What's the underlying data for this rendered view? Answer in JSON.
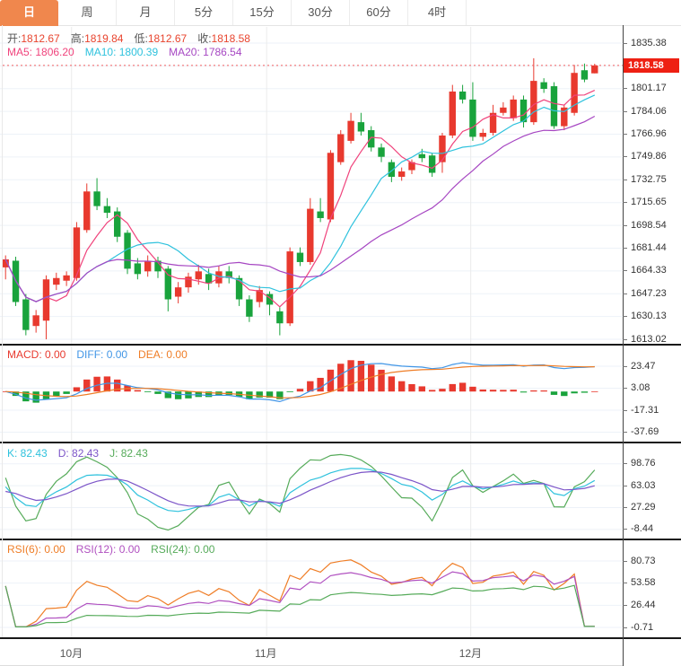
{
  "tabs": [
    {
      "label": "日",
      "active": true
    },
    {
      "label": "周",
      "active": false
    },
    {
      "label": "月",
      "active": false
    },
    {
      "label": "5分",
      "active": false
    },
    {
      "label": "15分",
      "active": false
    },
    {
      "label": "30分",
      "active": false
    },
    {
      "label": "60分",
      "active": false
    },
    {
      "label": "4时",
      "active": false
    }
  ],
  "ohlc_legend": [
    {
      "label": "开:",
      "value": "1812.67"
    },
    {
      "label": "高:",
      "value": "1819.84"
    },
    {
      "label": "低:",
      "value": "1812.67"
    },
    {
      "label": "收:",
      "value": "1818.58"
    }
  ],
  "ma_legend": [
    {
      "text": "MA5: 1806.20",
      "color": "#f0437c"
    },
    {
      "text": "MA10: 1800.39",
      "color": "#2fc2dd"
    },
    {
      "text": "MA20: 1786.54",
      "color": "#a646c2"
    }
  ],
  "macd_legend": [
    {
      "text": "MACD: 0.00",
      "color": "#e8392e"
    },
    {
      "text": "DIFF: 0.00",
      "color": "#4196e6"
    },
    {
      "text": "DEA: 0.00",
      "color": "#ef7d26"
    }
  ],
  "kdj_legend": [
    {
      "text": "K: 82.43",
      "color": "#2fc2dd"
    },
    {
      "text": "D: 82.43",
      "color": "#7c55c8"
    },
    {
      "text": "J: 82.43",
      "color": "#56ab5a"
    }
  ],
  "rsi_legend": [
    {
      "text": "RSI(6): 0.00",
      "color": "#ef7d26"
    },
    {
      "text": "RSI(12): 0.00",
      "color": "#b050c0"
    },
    {
      "text": "RSI(24): 0.00",
      "color": "#56ab5a"
    }
  ],
  "price_tag": "1818.58",
  "colors": {
    "up": "#e8392e",
    "down": "#19a33c",
    "ma5": "#f0437c",
    "ma10": "#2fc2dd",
    "ma20": "#a646c2",
    "diff": "#4196e6",
    "dea": "#ef7d26",
    "k": "#2fc2dd",
    "d_line": "#7c55c8",
    "j": "#56ab5a",
    "rsi6": "#ef7d26",
    "rsi12": "#b050c0",
    "rsi24": "#56ab5a",
    "tab_active": "#f0874d",
    "price_tag_bg": "#ee2013",
    "price_line": "#f26060",
    "grid_h": "#edf2f8",
    "grid_v": "#ebebeb",
    "legend_value_red": "#e8442e"
  },
  "chart_data": {
    "type": "candlestick",
    "timeframe": "日",
    "title": "Gold daily K-line with MA5/MA10/MA20, MACD, KDJ, RSI",
    "candles_ohlc_format": [
      "open",
      "high",
      "low",
      "close"
    ],
    "candles": [
      [
        1667,
        1676,
        1658,
        1673
      ],
      [
        1672,
        1675,
        1638,
        1641
      ],
      [
        1643,
        1647,
        1616,
        1620
      ],
      [
        1623,
        1635,
        1618,
        1631
      ],
      [
        1627,
        1661,
        1613,
        1658
      ],
      [
        1654,
        1663,
        1650,
        1659
      ],
      [
        1657,
        1664,
        1653,
        1661
      ],
      [
        1659,
        1701,
        1657,
        1697
      ],
      [
        1695,
        1730,
        1693,
        1724
      ],
      [
        1724,
        1734,
        1710,
        1713
      ],
      [
        1713,
        1719,
        1704,
        1708
      ],
      [
        1709,
        1712,
        1686,
        1690
      ],
      [
        1693,
        1695,
        1662,
        1666
      ],
      [
        1670,
        1674,
        1658,
        1662
      ],
      [
        1664,
        1676,
        1660,
        1672
      ],
      [
        1672,
        1675,
        1659,
        1664
      ],
      [
        1666,
        1668,
        1634,
        1643
      ],
      [
        1645,
        1656,
        1640,
        1652
      ],
      [
        1652,
        1663,
        1648,
        1660
      ],
      [
        1658,
        1669,
        1654,
        1664
      ],
      [
        1662,
        1666,
        1650,
        1655
      ],
      [
        1655,
        1668,
        1652,
        1664
      ],
      [
        1664,
        1668,
        1655,
        1659
      ],
      [
        1659,
        1661,
        1638,
        1643
      ],
      [
        1643,
        1646,
        1626,
        1630
      ],
      [
        1641,
        1653,
        1637,
        1650
      ],
      [
        1647,
        1649,
        1631,
        1639
      ],
      [
        1634,
        1637,
        1616,
        1625
      ],
      [
        1625,
        1682,
        1623,
        1679
      ],
      [
        1678,
        1682,
        1668,
        1671
      ],
      [
        1671,
        1719,
        1669,
        1711
      ],
      [
        1709,
        1719,
        1701,
        1704
      ],
      [
        1703,
        1755,
        1701,
        1753
      ],
      [
        1746,
        1770,
        1744,
        1767
      ],
      [
        1762,
        1783,
        1760,
        1777
      ],
      [
        1776,
        1783,
        1766,
        1769
      ],
      [
        1770,
        1773,
        1754,
        1757
      ],
      [
        1757,
        1760,
        1746,
        1750
      ],
      [
        1746,
        1748,
        1731,
        1735
      ],
      [
        1735,
        1742,
        1732,
        1739
      ],
      [
        1740,
        1748,
        1737,
        1746
      ],
      [
        1752,
        1756,
        1746,
        1749
      ],
      [
        1751,
        1753,
        1735,
        1738
      ],
      [
        1746,
        1768,
        1738,
        1766
      ],
      [
        1766,
        1804,
        1764,
        1799
      ],
      [
        1799,
        1804,
        1790,
        1793
      ],
      [
        1793,
        1806,
        1762,
        1765
      ],
      [
        1765,
        1771,
        1762,
        1768
      ],
      [
        1768,
        1789,
        1766,
        1783
      ],
      [
        1783,
        1791,
        1781,
        1787
      ],
      [
        1779,
        1796,
        1777,
        1793
      ],
      [
        1793,
        1796,
        1772,
        1776
      ],
      [
        1776,
        1824,
        1774,
        1807
      ],
      [
        1806,
        1809,
        1798,
        1801
      ],
      [
        1803,
        1806,
        1771,
        1773
      ],
      [
        1773,
        1789,
        1770,
        1787
      ],
      [
        1783,
        1819,
        1781,
        1813
      ],
      [
        1815,
        1820,
        1806,
        1808
      ],
      [
        1812.67,
        1819.84,
        1812.67,
        1818.58
      ]
    ],
    "overlays": [
      {
        "name": "MA5",
        "period": 5
      },
      {
        "name": "MA10",
        "period": 10
      },
      {
        "name": "MA20",
        "period": 20
      }
    ],
    "y_ticks": [
      "1835.38",
      "1801.17",
      "1784.06",
      "1766.96",
      "1749.86",
      "1732.75",
      "1715.65",
      "1698.54",
      "1681.44",
      "1664.33",
      "1647.23",
      "1630.13",
      "1613.02"
    ],
    "y_tick_step": 17.1046,
    "current_price": 1818.58,
    "month_gridlines": [
      {
        "label": "10月",
        "index": 6.5
      },
      {
        "label": "11月",
        "index": 25.7
      },
      {
        "label": "12月",
        "index": 45.8
      }
    ],
    "indicators": {
      "macd": {
        "ticks": [
          "23.47",
          "3.08",
          "-17.31",
          "-37.69"
        ],
        "params": [
          12,
          26,
          9
        ]
      },
      "kdj": {
        "ticks": [
          "98.76",
          "63.03",
          "27.29",
          "-8.44"
        ],
        "params": [
          9,
          3,
          3
        ]
      },
      "rsi": {
        "ticks": [
          "80.73",
          "53.58",
          "26.44",
          "-0.71"
        ],
        "params": [
          6,
          12,
          24
        ],
        "tail_flat_to_zero": 2
      }
    }
  }
}
